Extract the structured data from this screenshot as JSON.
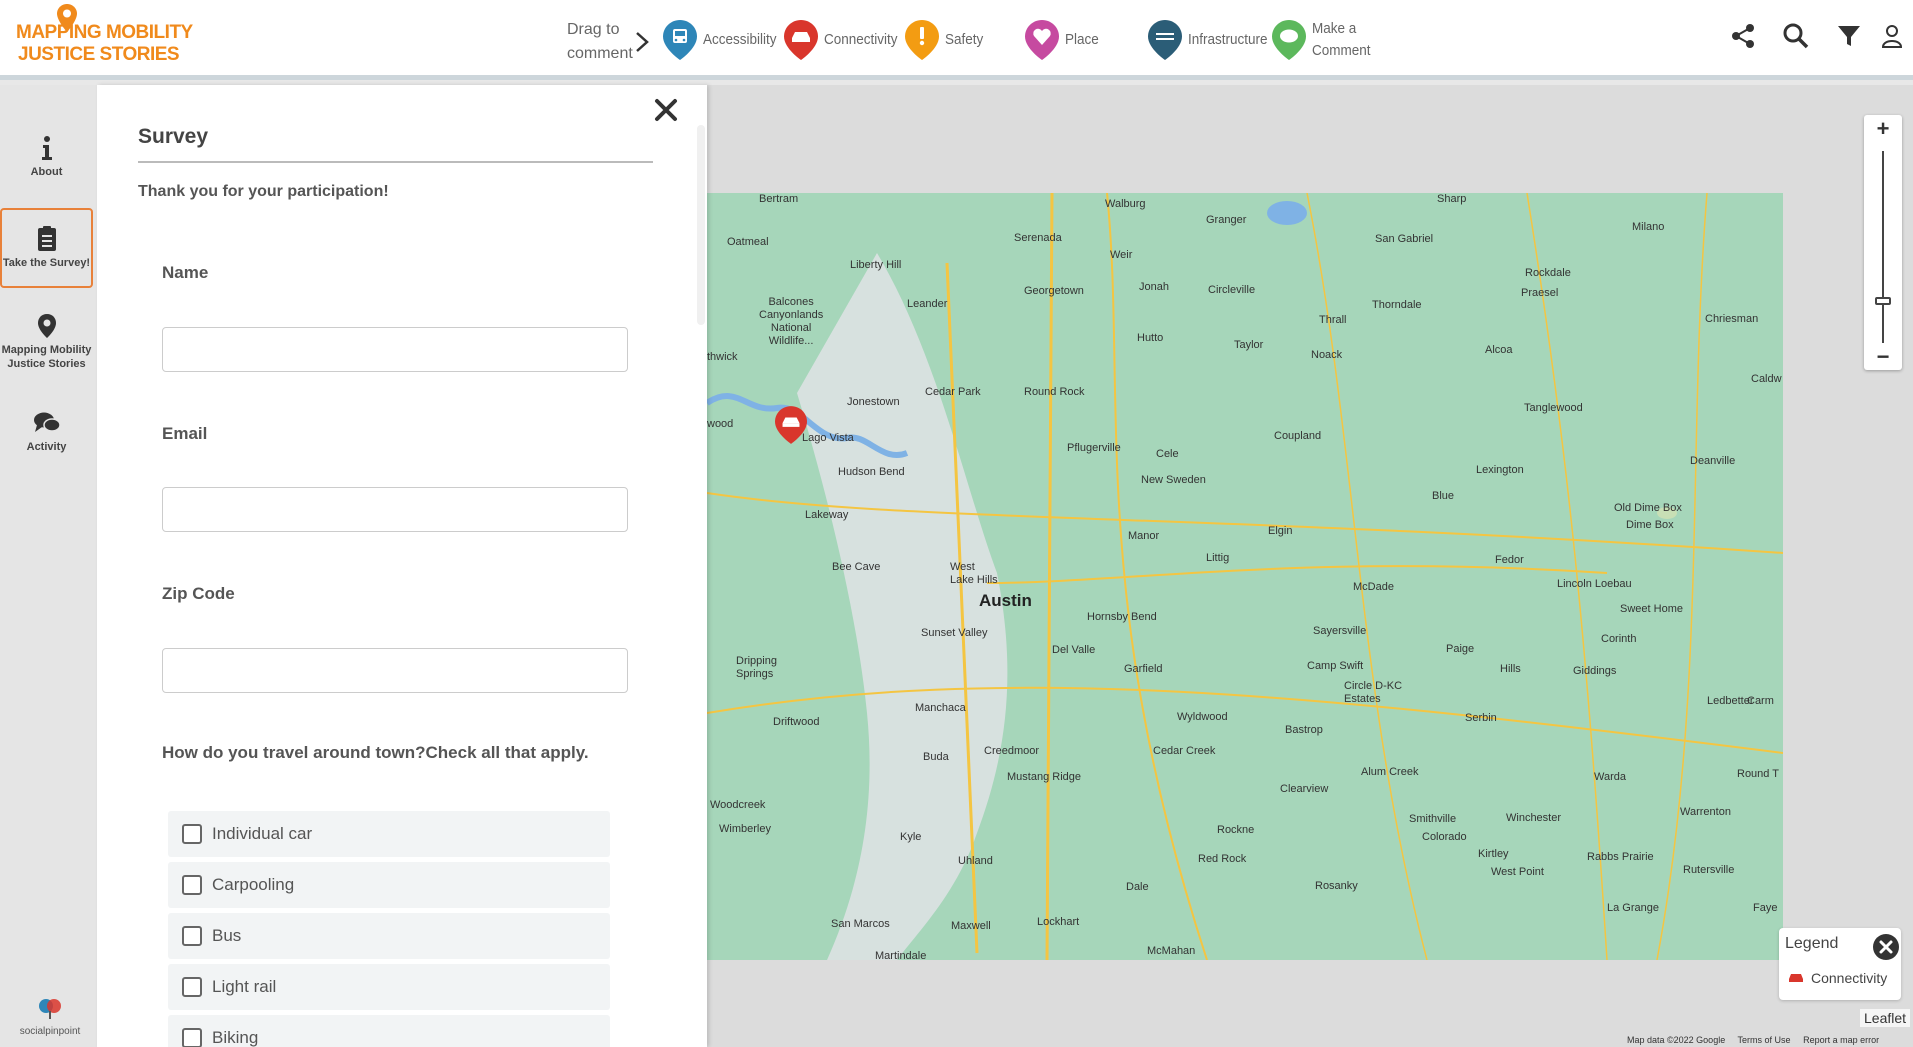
{
  "header": {
    "logo_line1": "MAPPING MOBILITY",
    "logo_line2": "JUSTICE STORIES",
    "drag_text_1": "Drag to",
    "drag_text_2": "comment",
    "categories": [
      {
        "label": "Accessibility",
        "icon": "bus-icon",
        "color": "#2e86b8"
      },
      {
        "label": "Connectivity",
        "icon": "car-icon",
        "color": "#d9362c"
      },
      {
        "label": "Safety",
        "icon": "exclamation-icon",
        "color": "#f39c12"
      },
      {
        "label": "Place",
        "icon": "heart-icon",
        "color": "#c64aa0"
      },
      {
        "label": "Infrastructure",
        "icon": "road-icon",
        "color": "#2b5d77"
      },
      {
        "label_1": "Make a",
        "label_2": "Comment",
        "icon": "comment-icon",
        "color": "#5cb85c"
      }
    ]
  },
  "rail": {
    "items": [
      {
        "label": "About",
        "icon": "info-icon"
      },
      {
        "label": "Take the Survey!",
        "icon": "clipboard-icon"
      },
      {
        "label_1": "Mapping Mobility",
        "label_2": "Justice Stories",
        "icon": "map-pin-icon"
      },
      {
        "label": "Activity",
        "icon": "chat-icon"
      }
    ],
    "brand": "socialpinpoint"
  },
  "survey": {
    "title": "Survey",
    "thanks": "Thank you for your participation!",
    "fields": [
      {
        "label": "Name",
        "value": ""
      },
      {
        "label": "Email",
        "value": ""
      },
      {
        "label": "Zip Code",
        "value": ""
      }
    ],
    "question": "How do you travel around town?Check all that apply.",
    "options": [
      "Individual car",
      "Carpooling",
      "Bus",
      "Light rail",
      "Biking"
    ]
  },
  "map": {
    "zoom_in": "+",
    "zoom_out": "−",
    "legend_title": "Legend",
    "legend_item": "Connectivity",
    "leaflet": "Leaflet",
    "attribution": [
      "Map data ©2022 Google",
      "Terms of Use",
      "Report a map error"
    ],
    "main_city": "Austin",
    "towns": [
      "Bertram",
      "Walburg",
      "Granger",
      "Oatmeal",
      "Serenada",
      "Weir",
      "San Gabriel",
      "Milano",
      "Liberty Hill",
      "Georgetown",
      "Jonah",
      "Circleville",
      "Thorndale",
      "Rockdale",
      "Praesel",
      "Leander",
      "Thrall",
      "Chriesman",
      "Balcones Canyonlands National Wildlife...",
      "Hutto",
      "Taylor",
      "Noack",
      "Alcoa",
      "Cedar Park",
      "Round Rock",
      "Jonestown",
      "Lago Vista",
      "Pflugerville",
      "Coupland",
      "Tanglewood",
      "Hudson Bend",
      "Cele",
      "New Sweden",
      "Lexington",
      "Deanville",
      "Lakeway",
      "Manor",
      "Elgin",
      "Blue",
      "Old Dime Box",
      "Dime Box",
      "Bee Cave",
      "West Lake Hills",
      "Littig",
      "Fedor",
      "McDade",
      "Lincoln Loebau",
      "Hornsby Bend",
      "Sayersville",
      "Sweet Home",
      "Sunset Valley",
      "Del Valle",
      "Garfield",
      "Camp Swift",
      "Circle D-KC Estates",
      "Paige",
      "Hills",
      "Giddings",
      "Corinth",
      "Dripping Springs",
      "Manchaca",
      "Wyldwood",
      "Bastrop",
      "Ledbetter",
      "Driftwood",
      "Creedmoor",
      "Cedar Creek",
      "Serbin",
      "Buda",
      "Mustang Ridge",
      "Alum Creek",
      "Warda",
      "Woodcreek",
      "Clearview",
      "Smithville",
      "Winchester",
      "Warrenton",
      "Wimberley",
      "Kyle",
      "Rockne",
      "Colorado",
      "Kirtley",
      "Rabbs Prairie",
      "Rutersville",
      "Uhland",
      "Red Rock",
      "Rosanky",
      "West Point",
      "La Grange",
      "Dale",
      "San Marcos",
      "Maxwell",
      "Lockhart",
      "McMahan",
      "Martindale",
      "Sharp",
      "Caldwell",
      "Round Top",
      "Carmine",
      "Fayetteville",
      "Wood",
      "thwick"
    ]
  }
}
